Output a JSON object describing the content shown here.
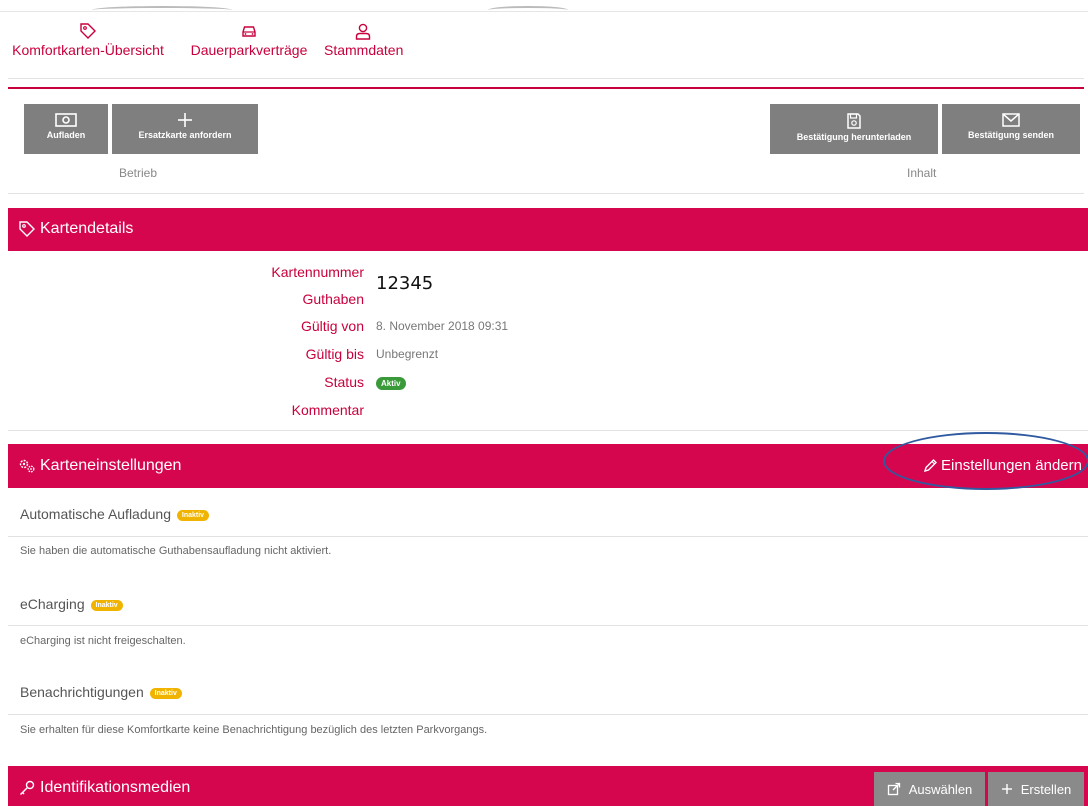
{
  "nav": {
    "items": [
      {
        "label": "Komfortkarten-Übersicht",
        "icon": "tag-icon"
      },
      {
        "label": "Dauerparkverträge",
        "icon": "car-icon"
      },
      {
        "label": "Stammdaten",
        "icon": "user-icon"
      }
    ]
  },
  "toolbar": {
    "aufladen": "Aufladen",
    "ersatzkarte": "Ersatzkarte anfordern",
    "bestaetigung_download": "Bestätigung herunterladen",
    "bestaetigung_send": "Bestätigung senden",
    "group_betrieb": "Betrieb",
    "group_inhalt": "Inhalt"
  },
  "kartendetails": {
    "title": "Kartendetails",
    "labels": {
      "kartennummer": "Kartennummer",
      "guthaben": "Guthaben",
      "gueltig_von": "Gültig von",
      "gueltig_bis": "Gültig bis",
      "status": "Status",
      "kommentar": "Kommentar"
    },
    "values": {
      "kartennummer": "12345",
      "gueltig_von": "8. November 2018 09:31",
      "gueltig_bis": "Unbegrenzt",
      "status": "Aktiv"
    }
  },
  "karteneinstellungen": {
    "title": "Karteneinstellungen",
    "edit_label": "Einstellungen ändern",
    "sections": [
      {
        "title": "Automatische Aufladung",
        "badge": "Inaktiv",
        "text": "Sie haben die automatische Guthabensaufladung nicht aktiviert."
      },
      {
        "title": "eCharging",
        "badge": "Inaktiv",
        "text": "eCharging ist nicht freigeschalten."
      },
      {
        "title": "Benachrichtigungen",
        "badge": "Inaktiv",
        "text": "Sie erhalten für diese Komfortkarte keine Benachrichtigung bezüglich des letzten Parkvorgangs."
      }
    ]
  },
  "identifikation": {
    "title": "Identifikationsmedien",
    "auswaehlen": "Auswählen",
    "erstellen": "Erstellen"
  },
  "colors": {
    "brand": "#d6064e",
    "button_gray": "#7f7f7f",
    "badge_active": "#3a9a3a",
    "badge_inactive": "#f0b400",
    "annotation_oval": "#2f5aa0"
  }
}
